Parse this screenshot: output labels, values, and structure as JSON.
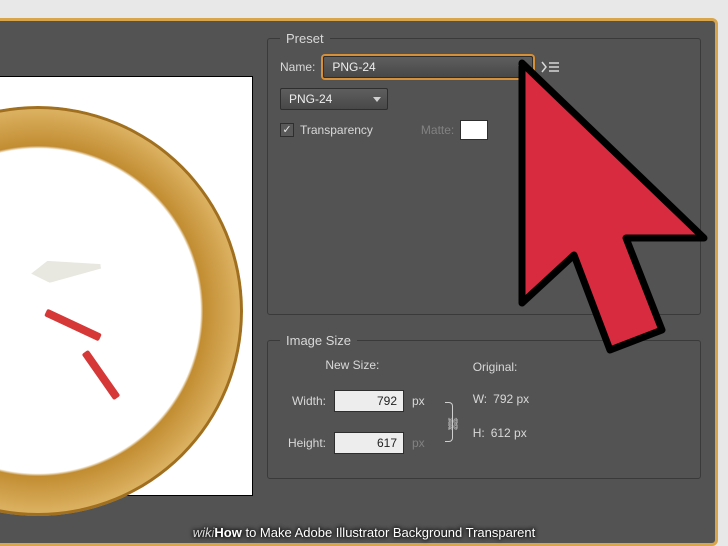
{
  "preset": {
    "legend": "Preset",
    "name_label": "Name:",
    "name_value": "PNG-24",
    "format_value": "PNG-24",
    "transparency_label": "Transparency",
    "transparency_checked": true,
    "matte_label": "Matte:"
  },
  "image_size": {
    "legend": "Image Size",
    "new_size_label": "New Size:",
    "width_label": "Width:",
    "height_label": "Height:",
    "width_value": "792",
    "height_value": "617",
    "unit": "px",
    "original_label": "Original:",
    "original_w_label": "W:",
    "original_h_label": "H:",
    "original_w": "792 px",
    "original_h": "612 px"
  },
  "watermark": {
    "prefix": "wiki",
    "bold": "How",
    "rest": " to Make Adobe Illustrator Background Transparent"
  }
}
